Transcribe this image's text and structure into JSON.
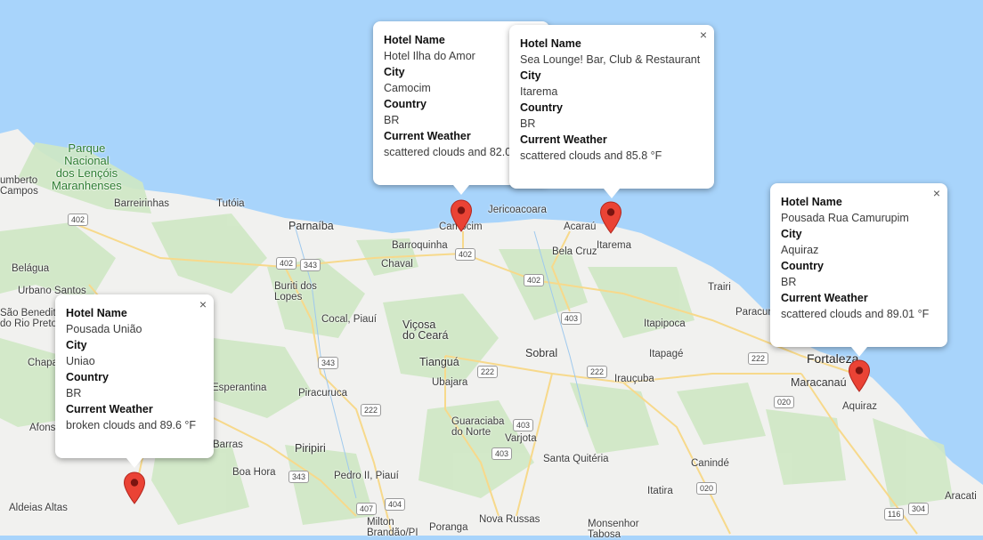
{
  "map": {
    "colors": {
      "water": "#a8d4fb",
      "land": "#f1f1ef",
      "green": "#cfe8c4",
      "road": "#f7d98b",
      "marker": "#ea4335"
    },
    "place_labels": [
      {
        "id": "parque",
        "text": "Parque\nNacional\ndos Lençóis\nMaranhenses",
        "style": "green"
      },
      {
        "id": "umberto",
        "text": "umberto\nCampos",
        "style": ""
      },
      {
        "id": "barreirinhas",
        "text": "Barreirinhas",
        "style": ""
      },
      {
        "id": "tutoia",
        "text": "Tutóia",
        "style": ""
      },
      {
        "id": "parnaiba",
        "text": "Parnaíba",
        "style": "med"
      },
      {
        "id": "barroquinha",
        "text": "Barroquinha",
        "style": ""
      },
      {
        "id": "chaval",
        "text": "Chaval",
        "style": ""
      },
      {
        "id": "camocim",
        "text": "Camocim",
        "style": ""
      },
      {
        "id": "jericoacoara",
        "text": "Jericoacoara",
        "style": ""
      },
      {
        "id": "acarau",
        "text": "Acaraú",
        "style": ""
      },
      {
        "id": "itarema",
        "text": "Itarema",
        "style": ""
      },
      {
        "id": "belacruz",
        "text": "Bela Cruz",
        "style": ""
      },
      {
        "id": "trairi",
        "text": "Trairi",
        "style": ""
      },
      {
        "id": "paracuru",
        "text": "Paracur",
        "style": ""
      },
      {
        "id": "belagua",
        "text": "Belágua",
        "style": ""
      },
      {
        "id": "urbanosantos",
        "text": "Urbano Santos",
        "style": ""
      },
      {
        "id": "saobenedito",
        "text": "São Benedito\ndo Rio Preto",
        "style": ""
      },
      {
        "id": "buriti",
        "text": "Buriti dos\nLopes",
        "style": ""
      },
      {
        "id": "cocal",
        "text": "Cocal, Piauí",
        "style": ""
      },
      {
        "id": "vicosa",
        "text": "Viçosa\ndo Ceará",
        "style": "med"
      },
      {
        "id": "tiangua",
        "text": "Tianguá",
        "style": "med"
      },
      {
        "id": "ubajara",
        "text": "Ubajara",
        "style": ""
      },
      {
        "id": "sobral",
        "text": "Sobral",
        "style": "med"
      },
      {
        "id": "itapipoca",
        "text": "Itapipoca",
        "style": ""
      },
      {
        "id": "itapage",
        "text": "Itapagé",
        "style": ""
      },
      {
        "id": "irauçuba",
        "text": "Irauçuba",
        "style": ""
      },
      {
        "id": "fortaleza",
        "text": "Fortaleza",
        "style": "big"
      },
      {
        "id": "maracanau",
        "text": "Maracanaú",
        "style": "med"
      },
      {
        "id": "aquiraz",
        "text": "Aquiraz",
        "style": ""
      },
      {
        "id": "chapa",
        "text": "Chapa",
        "style": ""
      },
      {
        "id": "esperantina",
        "text": "Esperantina",
        "style": ""
      },
      {
        "id": "piracuruca",
        "text": "Piracuruca",
        "style": ""
      },
      {
        "id": "afonso",
        "text": "Afons",
        "style": ""
      },
      {
        "id": "barras",
        "text": "Barras",
        "style": ""
      },
      {
        "id": "piripiri",
        "text": "Piripiri",
        "style": "med"
      },
      {
        "id": "boahora",
        "text": "Boa Hora",
        "style": ""
      },
      {
        "id": "pedroii",
        "text": "Pedro II, Piauí",
        "style": ""
      },
      {
        "id": "guaraciaba",
        "text": "Guaraciaba\ndo Norte",
        "style": ""
      },
      {
        "id": "varjota",
        "text": "Varjota",
        "style": ""
      },
      {
        "id": "santaquiteria",
        "text": "Santa Quitéria",
        "style": ""
      },
      {
        "id": "caninde",
        "text": "Canindé",
        "style": ""
      },
      {
        "id": "itatira",
        "text": "Itatira",
        "style": ""
      },
      {
        "id": "aracati",
        "text": "Aracati",
        "style": ""
      },
      {
        "id": "aldeias",
        "text": "Aldeias Altas",
        "style": ""
      },
      {
        "id": "milton",
        "text": "Milton\nBrandão/PI",
        "style": ""
      },
      {
        "id": "novarussas",
        "text": "Nova Russas",
        "style": ""
      },
      {
        "id": "monsenhor",
        "text": "Monsenhor\nTabosa",
        "style": ""
      },
      {
        "id": "poranga",
        "text": "Poranga",
        "style": ""
      }
    ],
    "road_shields": [
      {
        "id": "s402a",
        "text": "402"
      },
      {
        "id": "s402b",
        "text": "402"
      },
      {
        "id": "s343a",
        "text": "343"
      },
      {
        "id": "s402c",
        "text": "402"
      },
      {
        "id": "s402d",
        "text": "402"
      },
      {
        "id": "s403a",
        "text": "403"
      },
      {
        "id": "s343b",
        "text": "343"
      },
      {
        "id": "s222a",
        "text": "222"
      },
      {
        "id": "s222b",
        "text": "222"
      },
      {
        "id": "s222c",
        "text": "222"
      },
      {
        "id": "s222d",
        "text": "222"
      },
      {
        "id": "s020a",
        "text": "020"
      },
      {
        "id": "s403b",
        "text": "403"
      },
      {
        "id": "s403c",
        "text": "403"
      },
      {
        "id": "s343c",
        "text": "343"
      },
      {
        "id": "s407",
        "text": "407"
      },
      {
        "id": "s404",
        "text": "404"
      },
      {
        "id": "s020b",
        "text": "020"
      },
      {
        "id": "s116",
        "text": "116"
      },
      {
        "id": "s304",
        "text": "304"
      }
    ]
  },
  "infowindows": [
    {
      "id": "iw-camocim",
      "hotel_label": "Hotel Name",
      "hotel": "Hotel Ilha do Amor",
      "city_label": "City",
      "city": "Camocim",
      "country_label": "Country",
      "country": "BR",
      "weather_label": "Current Weather",
      "weather": "scattered clouds and 82.0",
      "close": ""
    },
    {
      "id": "iw-itarema",
      "hotel_label": "Hotel Name",
      "hotel": "Sea Lounge! Bar, Club & Restaurant",
      "city_label": "City",
      "city": "Itarema",
      "country_label": "Country",
      "country": "BR",
      "weather_label": "Current Weather",
      "weather": "scattered clouds and 85.8 °F",
      "close": "×"
    },
    {
      "id": "iw-aquiraz",
      "hotel_label": "Hotel Name",
      "hotel": "Pousada Rua Camurupim",
      "city_label": "City",
      "city": "Aquiraz",
      "country_label": "Country",
      "country": "BR",
      "weather_label": "Current Weather",
      "weather": "scattered clouds and 89.01 °F",
      "close": "×"
    },
    {
      "id": "iw-uniao",
      "hotel_label": "Hotel Name",
      "hotel": "Pousada União",
      "city_label": "City",
      "city": "Uniao",
      "country_label": "Country",
      "country": "BR",
      "weather_label": "Current Weather",
      "weather": "broken clouds and 89.6 °F",
      "close": "×"
    }
  ],
  "markers": [
    {
      "id": "mk-camocim",
      "icon": "map-pin-icon"
    },
    {
      "id": "mk-itarema",
      "icon": "map-pin-icon"
    },
    {
      "id": "mk-aquiraz",
      "icon": "map-pin-icon"
    },
    {
      "id": "mk-uniao",
      "icon": "map-pin-icon"
    }
  ]
}
